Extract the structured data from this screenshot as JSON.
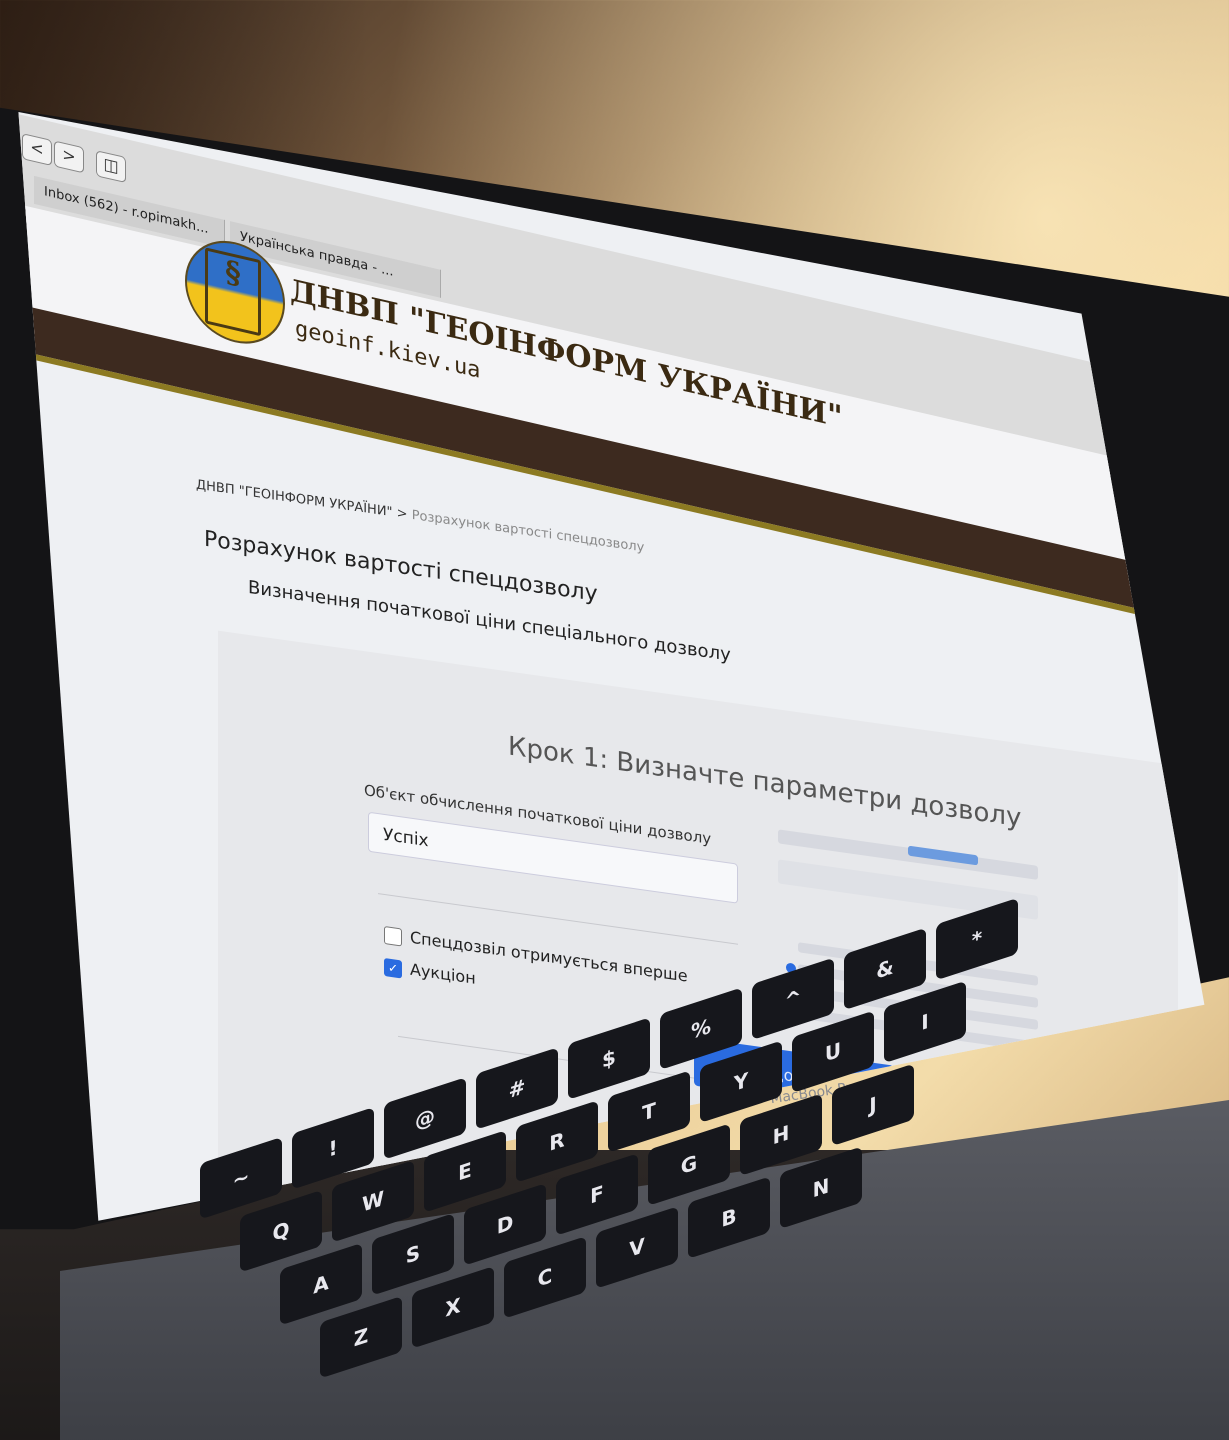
{
  "browser": {
    "tabs": [
      "Inbox (562) - r.opimakh...",
      "Українська правда - ..."
    ],
    "back_glyph": "<",
    "forward_glyph": ">"
  },
  "site": {
    "logo_text": "ДНВП \"ГЕОІНФОРМ УКРАЇНИ\"",
    "url": "geoinf.kiev.ua"
  },
  "breadcrumb": {
    "root": "ДНВП \"ГЕОІНФОРМ УКРАЇНИ\"",
    "separator": " > ",
    "current": "Розрахунок вартості спецдозволу"
  },
  "page": {
    "title": "Розрахунок вартості спецдозволу",
    "subtitle": "Визначення початкової ціни спеціального дозволу"
  },
  "form": {
    "step_title": "Крок 1: Визначте параметри дозволу",
    "object_label": "Об'єкт обчислення початкової ціни дозволу",
    "object_value": "Успіх",
    "checkbox_first_time": {
      "label": "Спецдозвіл отримується вперше",
      "checked": false
    },
    "checkbox_auction": {
      "label": "Аукціон",
      "checked": true
    },
    "submit_label": "Продовжити розрахунок"
  },
  "laptop": {
    "brand": "MacBook Pro"
  },
  "keyboard": {
    "rows": [
      [
        "~",
        "!",
        "@",
        "#",
        "$",
        "%",
        "^",
        "&",
        "*"
      ],
      [
        "Q",
        "W",
        "E",
        "R",
        "T",
        "Y",
        "U",
        "I"
      ],
      [
        "A",
        "S",
        "D",
        "F",
        "G",
        "H",
        "J"
      ],
      [
        "Z",
        "X",
        "C",
        "V",
        "B",
        "N"
      ]
    ]
  },
  "colors": {
    "accent": "#2a6be0",
    "header_band": "#3d2a1f",
    "header_gold": "#8c7a22"
  }
}
